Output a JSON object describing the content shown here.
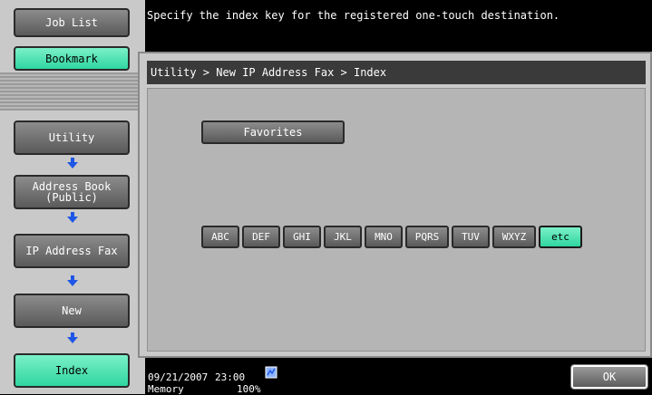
{
  "header": {
    "message": "Specify the index key for the registered one-touch destination."
  },
  "sidebar": {
    "job_list": "Job List",
    "bookmark": "Bookmark",
    "steps": [
      {
        "label": "Utility"
      },
      {
        "label": "Address Book\n(Public)"
      },
      {
        "label": "IP Address Fax"
      },
      {
        "label": "New"
      },
      {
        "label": "Index"
      }
    ]
  },
  "panel": {
    "breadcrumb": "Utility > New IP Address Fax > Index",
    "favorites": "Favorites",
    "index_keys": [
      "ABC",
      "DEF",
      "GHI",
      "JKL",
      "MNO",
      "PQRS",
      "TUV",
      "WXYZ",
      "etc"
    ],
    "selected_key": "etc"
  },
  "status": {
    "date": "09/21/2007",
    "time": "23:00",
    "memory_label": "Memory",
    "memory_value": "100%",
    "ok": "OK"
  },
  "colors": {
    "active": "#2fd6a0",
    "button_gray": "#6e6e6e",
    "arrow_blue": "#1e56e6"
  },
  "icons": [
    "down-arrow-icon",
    "network-status-icon"
  ]
}
